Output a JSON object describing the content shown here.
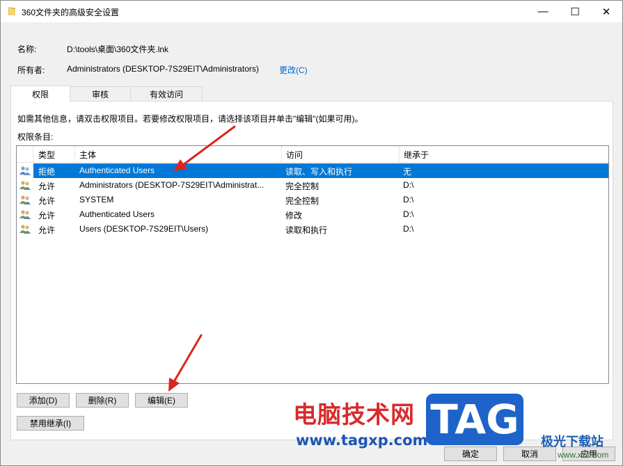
{
  "window": {
    "title": "360文件夹的高级安全设置",
    "minimize_glyph": "—",
    "maximize_glyph": "☐",
    "close_glyph": "✕"
  },
  "info": {
    "name_label": "名称:",
    "name_value": "D:\\tools\\桌面\\360文件夹.lnk",
    "owner_label": "所有者:",
    "owner_value": "Administrators (DESKTOP-7S29EIT\\Administrators)",
    "change_link": "更改(C)"
  },
  "tabs": [
    {
      "label": "权限",
      "active": true
    },
    {
      "label": "审核",
      "active": false
    },
    {
      "label": "有效访问",
      "active": false
    }
  ],
  "panel": {
    "hint": "如需其他信息，请双击权限项目。若要修改权限项目，请选择该项目并单击\"编辑\"(如果可用)。",
    "entries_label": "权限条目:"
  },
  "table": {
    "columns": [
      "类型",
      "主体",
      "访问",
      "继承于"
    ],
    "rows": [
      {
        "type": "拒绝",
        "principal": "Authenticated Users",
        "access": "读取、写入和执行",
        "inherited": "无",
        "selected": true
      },
      {
        "type": "允许",
        "principal": "Administrators (DESKTOP-7S29EIT\\Administrat...",
        "access": "完全控制",
        "inherited": "D:\\",
        "selected": false
      },
      {
        "type": "允许",
        "principal": "SYSTEM",
        "access": "完全控制",
        "inherited": "D:\\",
        "selected": false
      },
      {
        "type": "允许",
        "principal": "Authenticated Users",
        "access": "修改",
        "inherited": "D:\\",
        "selected": false
      },
      {
        "type": "允许",
        "principal": "Users (DESKTOP-7S29EIT\\Users)",
        "access": "读取和执行",
        "inherited": "D:\\",
        "selected": false
      }
    ]
  },
  "buttons": {
    "add": "添加(D)",
    "remove": "删除(R)",
    "edit": "编辑(E)",
    "disable_inheritance": "禁用继承(I)",
    "ok": "确定",
    "cancel": "取消",
    "apply": "应用"
  },
  "colors": {
    "selection": "#0078d7",
    "link": "#0066cc",
    "arrow": "#d9261c"
  },
  "watermark": {
    "site_name": "电脑技术网",
    "site_url": "www.tagxp.com",
    "logo": "TAG",
    "brand": "极光下载站",
    "brand_url": "www.xz7.com"
  }
}
